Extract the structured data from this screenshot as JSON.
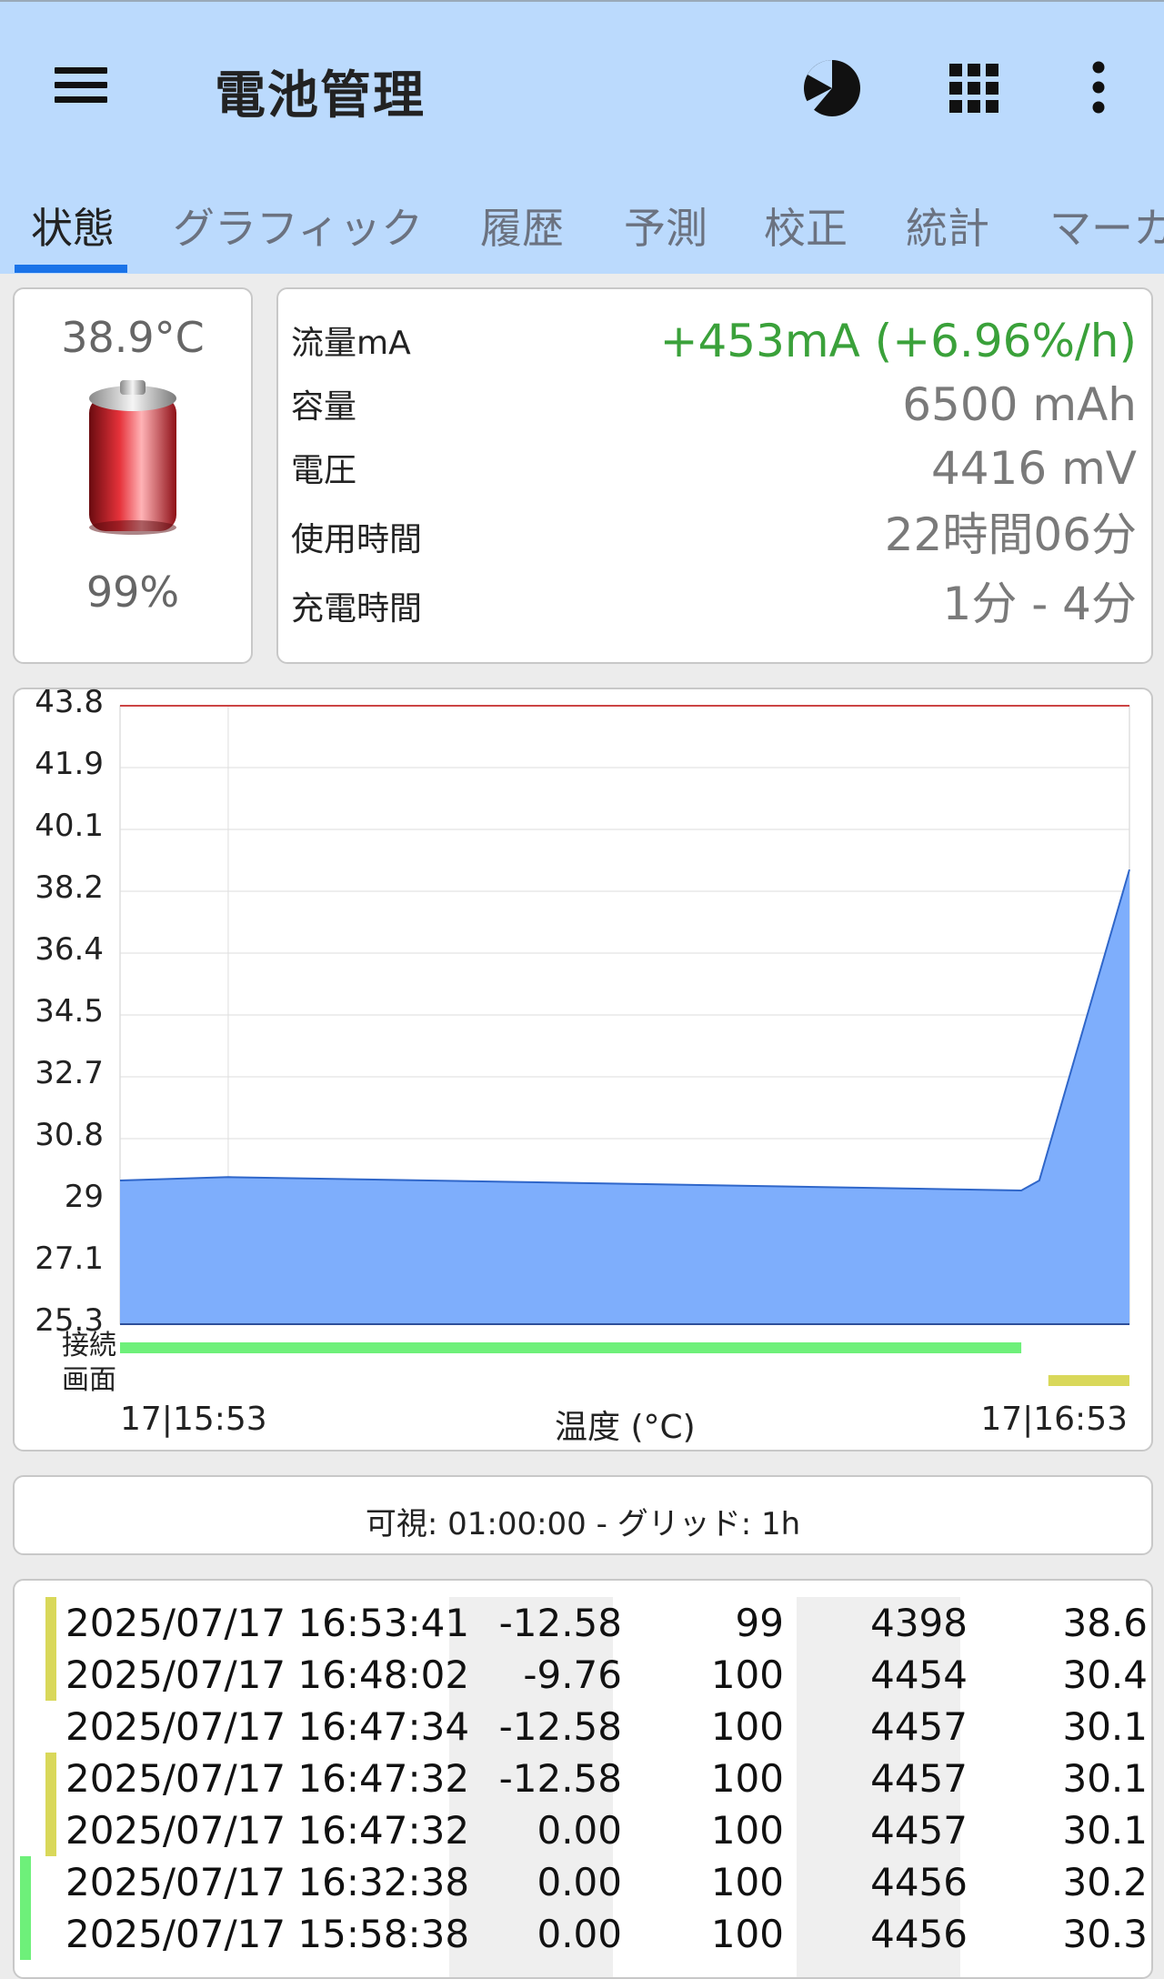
{
  "appbar": {
    "title": "電池管理",
    "icons": [
      "menu-icon",
      "pie-chart-icon",
      "grid-apps-icon",
      "more-vert-icon"
    ]
  },
  "tabs": [
    {
      "label": "状態",
      "active": true
    },
    {
      "label": "グラフィック",
      "active": false
    },
    {
      "label": "履歴",
      "active": false
    },
    {
      "label": "予測",
      "active": false
    },
    {
      "label": "校正",
      "active": false
    },
    {
      "label": "統計",
      "active": false
    },
    {
      "label": "マーカ",
      "active": false
    }
  ],
  "battery": {
    "temperature": "38.9°C",
    "level": "99%"
  },
  "info": [
    {
      "label": "流量mA",
      "value": "+453mA (+6.96%/h)",
      "green": true
    },
    {
      "label": "容量",
      "value": "6500 mAh",
      "green": false
    },
    {
      "label": "電圧",
      "value": "4416 mV",
      "green": false
    },
    {
      "label": "使用時間",
      "value": "22時間06分",
      "green": false
    },
    {
      "label": "充電時間",
      "value": "1分 - 4分",
      "green": false
    }
  ],
  "chart_data": {
    "type": "area",
    "title": "温度 (°C)",
    "yticks": [
      "43.8",
      "41.9",
      "40.1",
      "38.2",
      "36.4",
      "34.5",
      "32.7",
      "30.8",
      "29",
      "27.1",
      "25.3"
    ],
    "ylim": [
      25.3,
      43.8
    ],
    "x_start_label": "17|15:53",
    "x_end_label": "17|16:53",
    "x": [
      0,
      12,
      100,
      102,
      112
    ],
    "values": [
      29.6,
      29.7,
      29.3,
      29.6,
      38.9
    ],
    "max_line": 43.8,
    "grid": true,
    "colors": {
      "fill": "#7eaefc",
      "line": "#2f66c9",
      "max_line": "#cc4444"
    },
    "tracks": [
      {
        "label": "接続",
        "color": "#6ef07a"
      },
      {
        "label": "画面",
        "color": "#d9d85a"
      }
    ]
  },
  "visible": {
    "text": "可視: 01:00:00 - グリッド: 1h"
  },
  "log": [
    {
      "datetime": "2025/07/17 16:53:41",
      "current": "-12.58",
      "level": "99",
      "voltage": "4398",
      "temp": "38.6",
      "marker": "#d9d85a"
    },
    {
      "datetime": "2025/07/17 16:48:02",
      "current": "-9.76",
      "level": "100",
      "voltage": "4454",
      "temp": "30.4",
      "marker": "#d9d85a"
    },
    {
      "datetime": "2025/07/17 16:47:34",
      "current": "-12.58",
      "level": "100",
      "voltage": "4457",
      "temp": "30.1",
      "marker": ""
    },
    {
      "datetime": "2025/07/17 16:47:32",
      "current": "-12.58",
      "level": "100",
      "voltage": "4457",
      "temp": "30.1",
      "marker": "#d9d85a"
    },
    {
      "datetime": "2025/07/17 16:47:32",
      "current": "0.00",
      "level": "100",
      "voltage": "4457",
      "temp": "30.1",
      "marker": "#d9d85a"
    },
    {
      "datetime": "2025/07/17 16:32:38",
      "current": "0.00",
      "level": "100",
      "voltage": "4456",
      "temp": "30.2",
      "marker": "#6ef07a"
    },
    {
      "datetime": "2025/07/17 15:58:38",
      "current": "0.00",
      "level": "100",
      "voltage": "4456",
      "temp": "30.3",
      "marker": "#6ef07a"
    }
  ]
}
